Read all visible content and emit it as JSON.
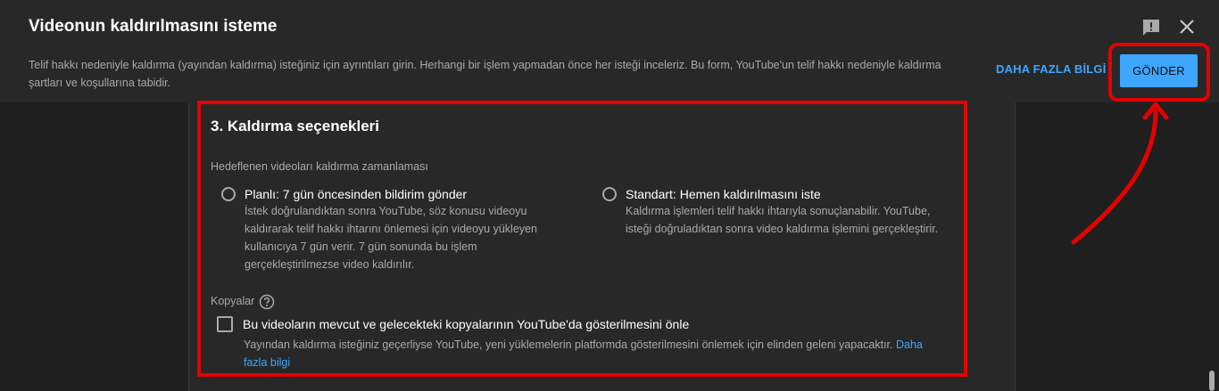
{
  "dialog": {
    "title": "Videonun kaldırılmasını isteme",
    "description": "Telif hakkı nedeniyle kaldırma (yayından kaldırma) isteğiniz için ayrıntıları girin. Herhangi bir işlem yapmadan önce her isteği inceleriz. Bu form, YouTube'un telif hakkı nedeniyle kaldırma şartları ve koşullarına tabidir.",
    "learn_more_label": "DAHA FAZLA BİLGİ",
    "submit_label": "GÖNDER"
  },
  "icons": {
    "feedback": "feedback-icon",
    "close": "close-icon",
    "help": "help-circle-icon"
  },
  "section": {
    "title": "3. Kaldırma seçenekleri",
    "schedule_label": "Hedeflenen videoları kaldırma zamanlaması",
    "options": [
      {
        "title": "Planlı: 7 gün öncesinden bildirim gönder",
        "desc_lines": [
          "İstek doğrulandıktan sonra YouTube, söz konusu videoyu",
          "kaldırarak telif hakkı ihtarını önlemesi için videoyu yükleyen",
          "kullanıcıya 7 gün verir. 7 gün sonunda bu işlem",
          "gerçekleştirilmezse video kaldırılır."
        ],
        "selected": false
      },
      {
        "title": "Standart: Hemen kaldırılmasını iste",
        "desc_lines": [
          "Kaldırma işlemleri telif hakkı ihtarıyla sonuçlanabilir. YouTube,",
          "isteği doğruladıktan sonra video kaldırma işlemini gerçekleştirir."
        ],
        "selected": false
      }
    ],
    "copies_label": "Kopyalar",
    "copies_option": {
      "title": "Bu videoların mevcut ve gelecekteki kopyalarının YouTube'da gösterilmesini önle",
      "desc": "Yayından kaldırma isteğiniz geçerliyse YouTube, yeni yüklemelerin platformda gösterilmesini önlemek için elinden geleni yapacaktır.",
      "link_part1": "Daha",
      "link_part2": "fazla bilgi",
      "checked": false
    }
  },
  "colors": {
    "accent": "#3ea6ff",
    "highlight": "#e50000",
    "background": "#1f1f1f",
    "surface": "#282828"
  }
}
